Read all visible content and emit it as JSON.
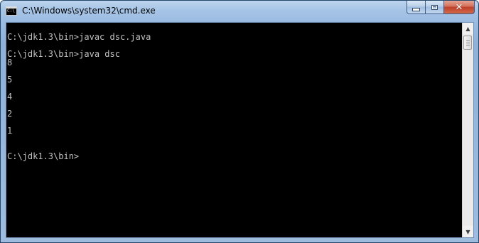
{
  "window": {
    "title": "C:\\Windows\\system32\\cmd.exe",
    "icon": "cmd-icon",
    "icon_text": "C:\\"
  },
  "caption_buttons": {
    "minimize": "minimize-icon",
    "maximize": "maximize-icon",
    "close_glyph": "✕"
  },
  "console": {
    "lines": [
      "",
      "C:\\jdk1.3\\bin>javac dsc.java",
      "",
      "C:\\jdk1.3\\bin>java dsc",
      "8",
      "",
      "5",
      "",
      "4",
      "",
      "2",
      "",
      "1",
      "",
      "",
      "C:\\jdk1.3\\bin>"
    ]
  },
  "scrollbar": {
    "up_arrow": "▲",
    "down_arrow": "▼"
  }
}
